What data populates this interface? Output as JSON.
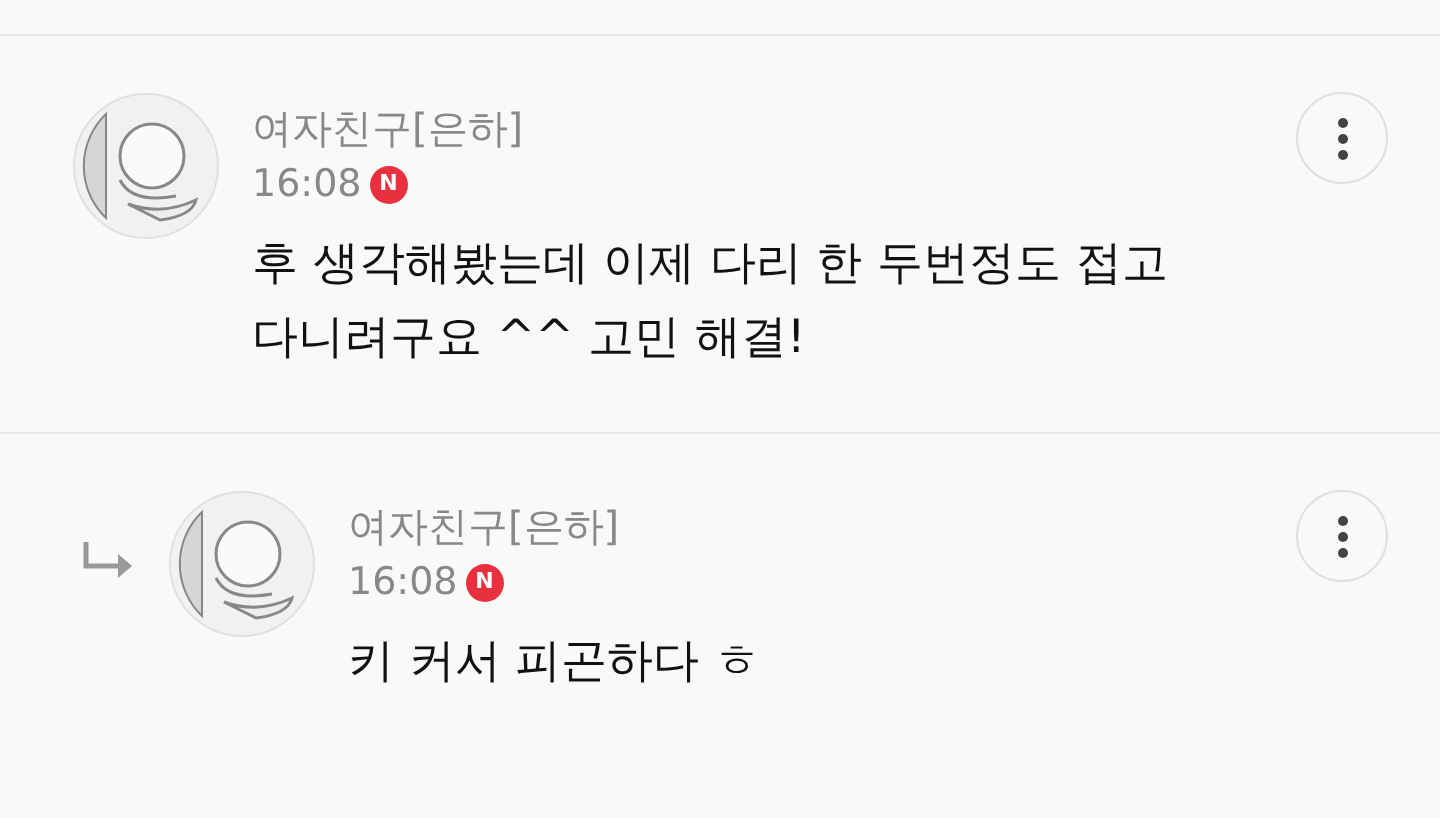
{
  "comments": [
    {
      "kind": "comment",
      "author": "여자친구[은하]",
      "time": "16:08",
      "new_badge": "N",
      "text": [
        "후 생각해봤는데 이제 다리 한 두번정도 접고",
        "다니려구요 ^^ 고민 해결!"
      ]
    },
    {
      "kind": "reply",
      "author": "여자친구[은하]",
      "time": "16:08",
      "new_badge": "N",
      "text": [
        "키 커서 피곤하다 ㅎ"
      ]
    }
  ]
}
